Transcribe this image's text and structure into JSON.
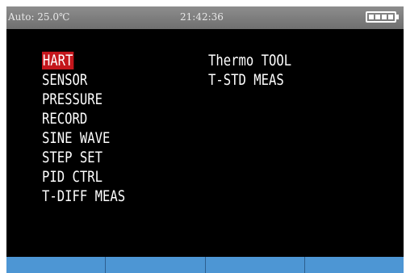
{
  "status": {
    "temperature": "Auto: 25.0℃",
    "time": "21:42:36",
    "battery_icon": "battery-full-icon"
  },
  "menu": {
    "left": [
      "HART",
      "SENSOR",
      "PRESSURE",
      "RECORD",
      "SINE WAVE",
      "STEP SET",
      "PID CTRL",
      "T-DIFF MEAS"
    ],
    "right": [
      "Thermo TOOL",
      "T-STD MEAS"
    ],
    "selected": "HART"
  },
  "colors": {
    "screen_bg": "#000000",
    "status_bar": "#7f7f7f",
    "selection": "#c4161c",
    "softkey": "#4d96d4"
  },
  "softkeys": [
    "",
    "",
    "",
    ""
  ]
}
